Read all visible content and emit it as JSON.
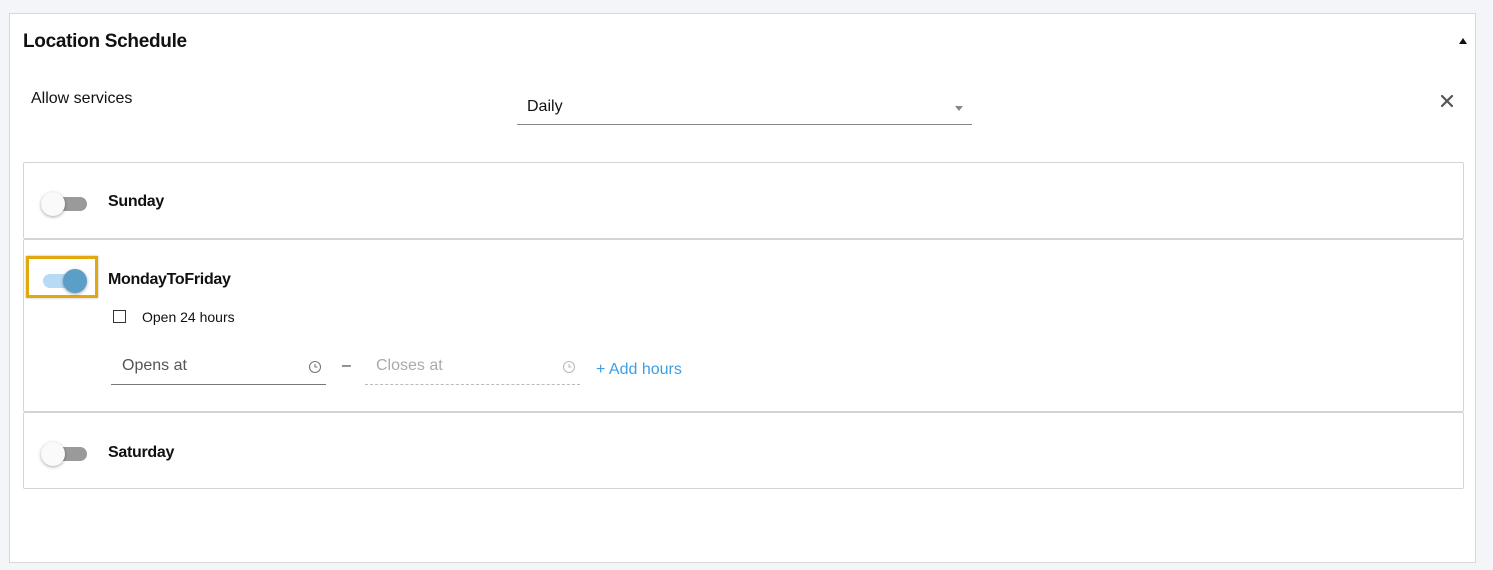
{
  "section": {
    "title": "Location Schedule",
    "collapse_icon": "triangle-up-icon"
  },
  "allow_services": {
    "label": "Allow services",
    "selected": "Daily",
    "caret_icon": "caret-down-icon",
    "clear_icon": "close-icon"
  },
  "days": [
    {
      "name": "Sunday",
      "enabled": false
    },
    {
      "name": "MondayToFriday",
      "enabled": true,
      "open_24_label": "Open 24 hours",
      "open_24_checked": false,
      "opens_placeholder": "Opens at",
      "closes_placeholder": "Closes at",
      "separator": "–",
      "add_hours_label": "+ Add hours"
    },
    {
      "name": "Saturday",
      "enabled": false
    }
  ],
  "colors": {
    "focus_ring": "#e2a90f",
    "toggle_on_thumb": "#5b9ec7",
    "toggle_on_track": "#b6dcf5",
    "toggle_off_track": "#9a9a9a",
    "link": "#3c9ee5"
  }
}
